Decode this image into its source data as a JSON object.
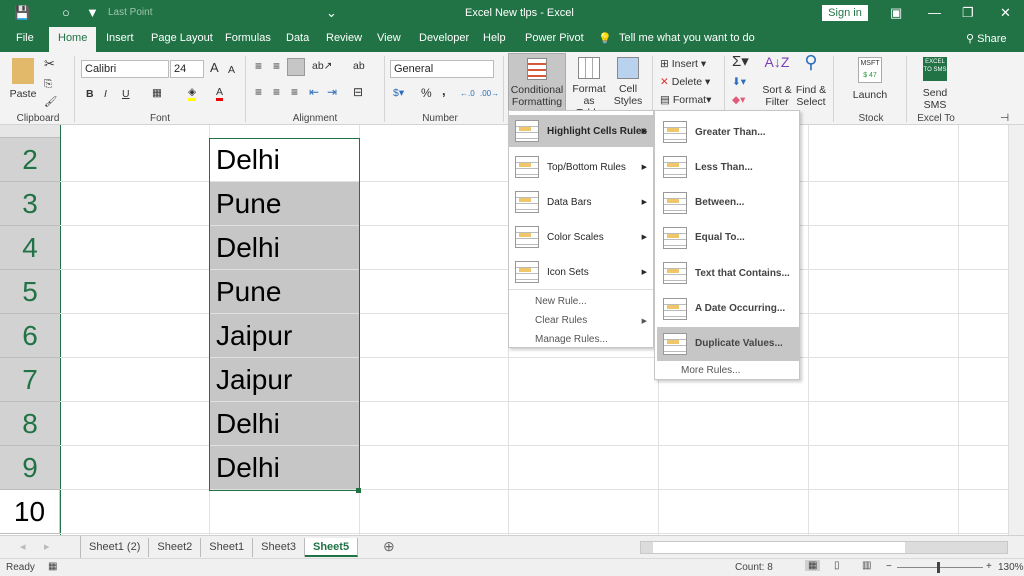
{
  "titlebar": {
    "title": "Excel New tlps  -  Excel",
    "sign_in": "Sign in",
    "qat_last_point": "Last Point"
  },
  "ribbon_tabs": [
    "File",
    "Home",
    "Insert",
    "Page Layout",
    "Formulas",
    "Data",
    "Review",
    "View",
    "Developer",
    "Help",
    "Power Pivot"
  ],
  "tell_me": "Tell me what you want to do",
  "share": "Share",
  "ribbon": {
    "clipboard": {
      "label": "Clipboard",
      "paste": "Paste"
    },
    "font": {
      "label": "Font",
      "name": "Calibri",
      "size": "24",
      "bold": "B",
      "italic": "I",
      "underline": "U"
    },
    "alignment": {
      "label": "Alignment"
    },
    "number": {
      "label": "Number",
      "format": "General",
      "percent": "%",
      "comma": ","
    },
    "styles": {
      "conditional_1": "Conditional",
      "conditional_2": "Formatting",
      "format_table_1": "Format as",
      "format_table_2": "Table",
      "cell_styles_1": "Cell",
      "cell_styles_2": "Styles"
    },
    "cells": {
      "insert": "Insert",
      "delete": "Delete",
      "format": "Format"
    },
    "editing": {
      "sort_1": "Sort &",
      "sort_2": "Filter",
      "find_1": "Find &",
      "find_2": "Select"
    },
    "stock": {
      "ticker": "MSFT",
      "price": "$ 47",
      "launch": "Launch",
      "label": "Stock Connector"
    },
    "sms": {
      "logo": "EXCEL TO SMS",
      "send_1": "Send",
      "send_2": "SMS",
      "label": "Excel To SMS"
    }
  },
  "grid": {
    "rows": [
      {
        "num": "2",
        "value": "Delhi"
      },
      {
        "num": "3",
        "value": "Pune"
      },
      {
        "num": "4",
        "value": "Delhi"
      },
      {
        "num": "5",
        "value": "Pune"
      },
      {
        "num": "6",
        "value": "Jaipur"
      },
      {
        "num": "7",
        "value": "Jaipur"
      },
      {
        "num": "8",
        "value": "Delhi"
      },
      {
        "num": "9",
        "value": "Delhi"
      },
      {
        "num": "10",
        "value": ""
      }
    ]
  },
  "cf_menu": {
    "items": [
      "Highlight Cells Rules",
      "Top/Bottom Rules",
      "Data Bars",
      "Color Scales",
      "Icon Sets"
    ],
    "small": [
      "New Rule...",
      "Clear Rules",
      "Manage Rules..."
    ]
  },
  "highlight_submenu": {
    "items": [
      "Greater Than...",
      "Less Than...",
      "Between...",
      "Equal To...",
      "Text that Contains...",
      "A Date Occurring...",
      "Duplicate Values..."
    ],
    "more": "More Rules..."
  },
  "sheets": [
    "Sheet1 (2)",
    "Sheet2",
    "Sheet1",
    "Sheet3",
    "Sheet5"
  ],
  "active_sheet": "Sheet5",
  "status": {
    "ready": "Ready",
    "count": "Count: 8",
    "zoom": "130%"
  },
  "colors": {
    "brand": "#217346",
    "selected_fill": "#c6c6c6"
  }
}
